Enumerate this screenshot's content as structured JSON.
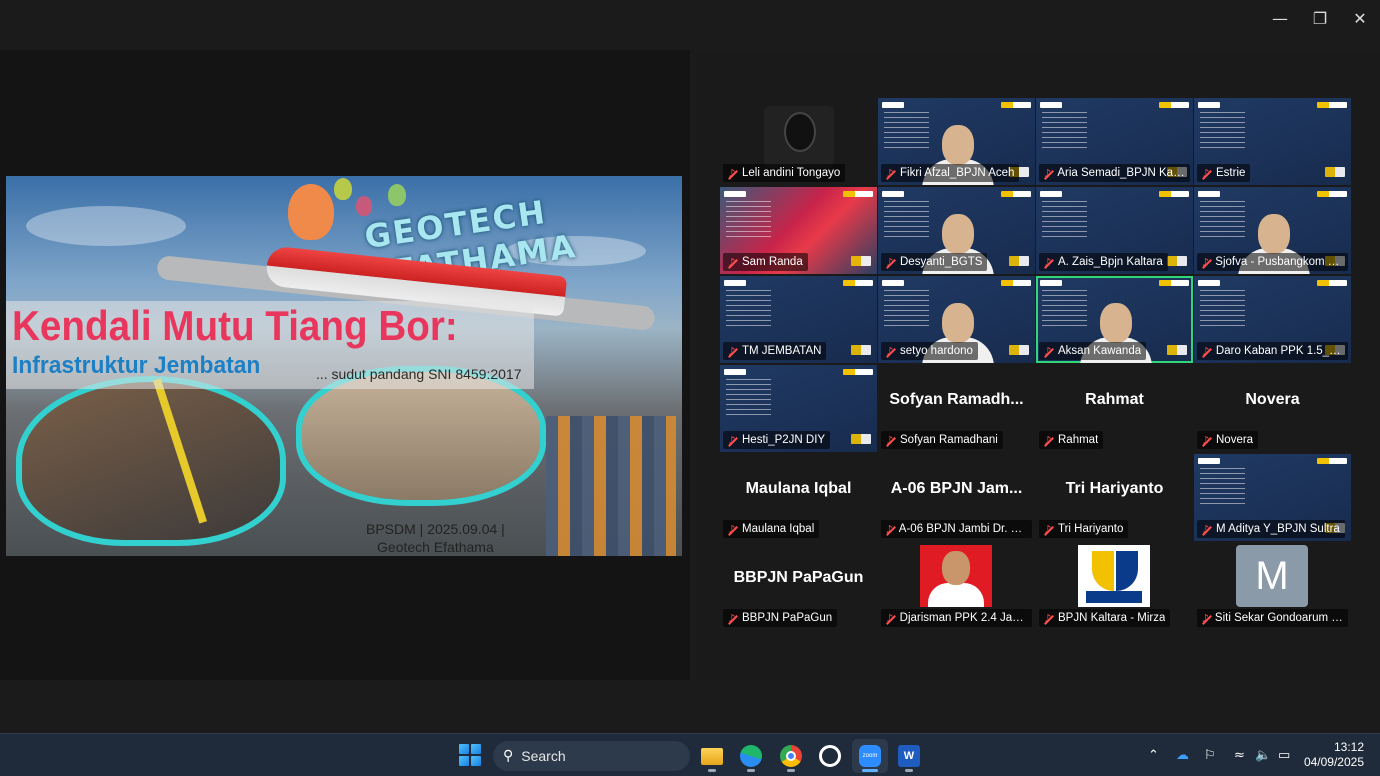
{
  "window": {
    "minimize_icon": "minimize-icon",
    "restore_icon": "restore-icon",
    "close_icon": "close-icon"
  },
  "slide": {
    "brand": "GEOTECH EFATHAMA",
    "title": "Kendali Mutu Tiang Bor:",
    "subtitle": "Infrastruktur Jembatan",
    "tagline": "... sudut pandang SNI 8459:2017",
    "footer_line1": "BPSDM | 2025.09.04 |",
    "footer_line2": "Geotech Efathama"
  },
  "participants": [
    {
      "name": "Leli andini Tongayo",
      "big": "",
      "type": "photo-leli"
    },
    {
      "name": "Fikri Afzal_BPJN Aceh",
      "big": "",
      "type": "video-person"
    },
    {
      "name": "Aria Semadi_BPJN Kalbar",
      "big": "",
      "type": "video-deck"
    },
    {
      "name": "Estrie",
      "big": "",
      "type": "video-deck"
    },
    {
      "name": "Sam Randa",
      "big": "",
      "type": "video-red"
    },
    {
      "name": "Desyanti_BGTS",
      "big": "",
      "type": "video-person"
    },
    {
      "name": "A. Zais_Bpjn Kaltara",
      "big": "",
      "type": "video-deck"
    },
    {
      "name": "Sjofva - Pusbangkom BP...",
      "big": "",
      "type": "video-person"
    },
    {
      "name": "TM JEMBATAN",
      "big": "",
      "type": "video-deck"
    },
    {
      "name": "setyo hardono",
      "big": "",
      "type": "video-person"
    },
    {
      "name": "Aksan Kawanda",
      "big": "",
      "type": "video-person-active"
    },
    {
      "name": "Daro Kaban PPK 1.5_Jbi",
      "big": "",
      "type": "video-deck"
    },
    {
      "name": "Hesti_P2JN DIY",
      "big": "",
      "type": "video-deck"
    },
    {
      "name": "Sofyan Ramadhani",
      "big": "Sofyan Ramadh...",
      "type": "text"
    },
    {
      "name": "Rahmat",
      "big": "Rahmat",
      "type": "text"
    },
    {
      "name": "Novera",
      "big": "Novera",
      "type": "text"
    },
    {
      "name": "Maulana Iqbal",
      "big": "Maulana Iqbal",
      "type": "text"
    },
    {
      "name": "A-06 BPJN Jambi Dr. Ded...",
      "big": "A-06 BPJN Jam...",
      "type": "text"
    },
    {
      "name": "Tri Hariyanto",
      "big": "Tri Hariyanto",
      "type": "text"
    },
    {
      "name": "M Aditya Y_BPJN Sultra",
      "big": "",
      "type": "video-deck"
    },
    {
      "name": "BBPJN PaPaGun",
      "big": "BBPJN PaPaGun",
      "type": "text"
    },
    {
      "name": "Djarisman PPK 2.4 Jambi",
      "big": "",
      "type": "avatar-red"
    },
    {
      "name": "BPJN Kaltara - Mirza",
      "big": "",
      "type": "avatar-pu"
    },
    {
      "name": "Siti Sekar Gondoarum - B...",
      "big": "",
      "type": "avatar-m",
      "initial": "M"
    }
  ],
  "taskbar": {
    "search_label": "Search",
    "apps": [
      "file-explorer",
      "edge",
      "chrome",
      "whatsapp",
      "zoom",
      "word"
    ],
    "zoom_label": "zoom",
    "word_label": "W",
    "time": "13:12",
    "date": "04/09/2025"
  },
  "colors": {
    "active_speaker": "#2fd67a",
    "muted": "#ff4d4d",
    "title_pink": "#e8365d",
    "title_blue": "#1d7fc4"
  }
}
